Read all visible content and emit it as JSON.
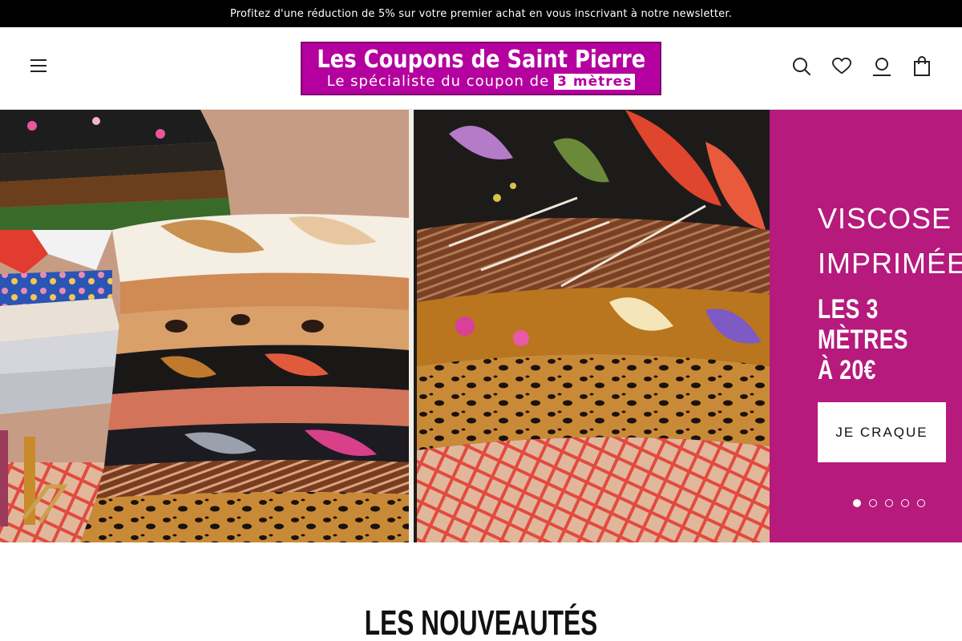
{
  "announcement": "Profitez d'une réduction de 5% sur votre premier achat en vous inscrivant à notre newsletter.",
  "header": {
    "logo_title": "Les Coupons de Saint Pierre",
    "logo_tagline": "Le spécialiste du coupon de",
    "logo_tagline_box": "3 mètres",
    "icons": [
      "menu-icon",
      "search-icon",
      "heart-icon",
      "user-icon",
      "bag-icon"
    ]
  },
  "hero": {
    "heading": "VISCOSE IMPRIMÉE",
    "offer": "LES 3 MÈTRES À 20€",
    "cta_label": "JE CRAQUE",
    "slide_count": 5,
    "active_slide": 1,
    "colors": {
      "panel": "#b51a7c",
      "accent_logo": "#b4009e"
    }
  },
  "section": {
    "title": "LES NOUVEAUTÉS"
  }
}
